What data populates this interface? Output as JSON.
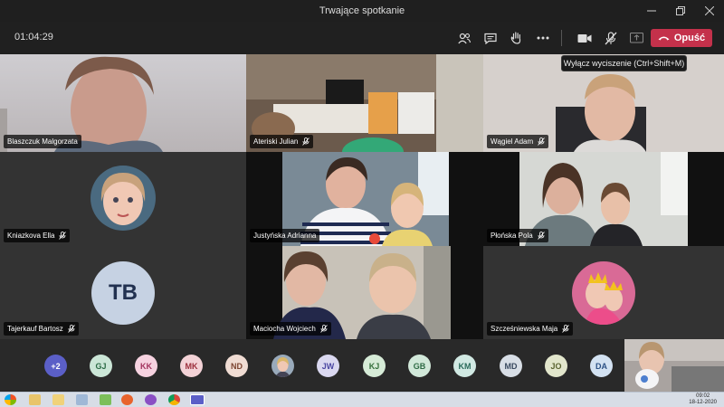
{
  "window": {
    "title": "Trwające spotkanie"
  },
  "toolbar": {
    "timer": "01:04:29",
    "leave_label": "Opuść",
    "tooltip": "Wyłącz wyciszenie (Ctrl+Shift+M)"
  },
  "tiles": [
    {
      "name": "Blaszczuk Malgorzata",
      "muted": false
    },
    {
      "name": "Ateriski Julian",
      "muted": true
    },
    {
      "name": "Wągiel Adam",
      "muted": true
    },
    {
      "name": "Kniazkova Ella",
      "muted": true
    },
    {
      "name": "Justyńska Adrianna",
      "muted": false
    },
    {
      "name": "Płońska Pola",
      "muted": true
    },
    {
      "name": "Tajerkauf Bartosz",
      "muted": true,
      "initials": "TB"
    },
    {
      "name": "Maciocha Wojciech",
      "muted": true
    },
    {
      "name": "Szcześniewska Maja",
      "muted": true
    }
  ],
  "avatar_bar": {
    "overflow": "+2",
    "participants": [
      "GJ",
      "KK",
      "MK",
      "ND",
      "",
      "JW",
      "KJ",
      "GB",
      "KM",
      "MD",
      "JO",
      "DA"
    ]
  },
  "taskbar": {
    "time": "09:02",
    "date": "18-12-2020"
  }
}
